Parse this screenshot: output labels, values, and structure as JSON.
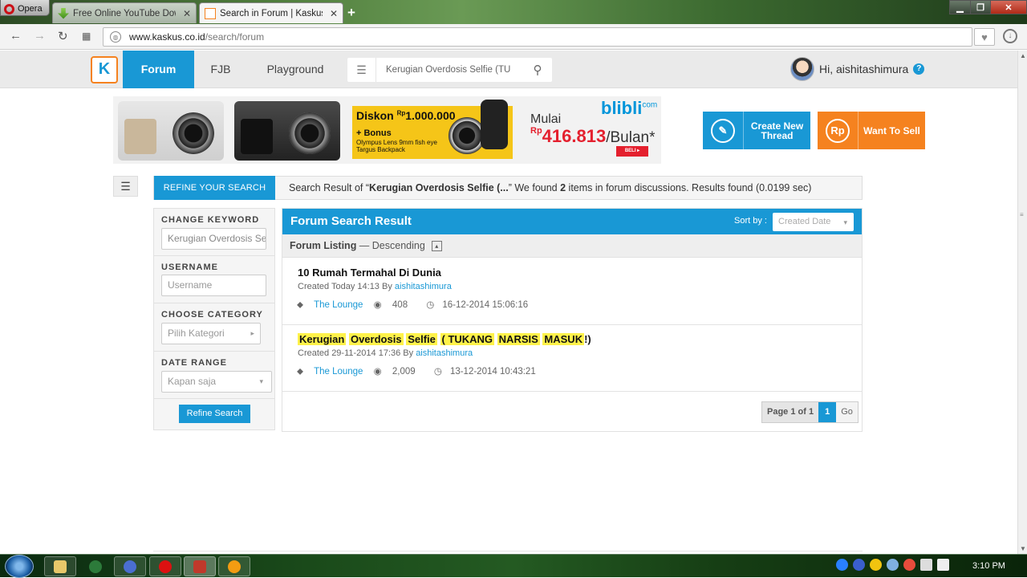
{
  "browser": {
    "menu_label": "Opera",
    "tabs": [
      {
        "title": "Free Online YouTube Dow",
        "active": false
      },
      {
        "title": "Search in Forum | Kaskus -",
        "active": true
      }
    ],
    "new_tab": "+",
    "url_host": "www.kaskus.co.id",
    "url_path": "/search/forum"
  },
  "site": {
    "logo_text": "K",
    "nav": {
      "forum": "Forum",
      "fjb": "FJB",
      "playground": "Playground"
    },
    "search_value": "Kerugian Overdosis Selfie (TU",
    "user_greeting": "Hi, aishitashimura",
    "help": "?"
  },
  "banner": {
    "diskon": "Diskon",
    "diskon_amount": "1.000.000",
    "bonus": "+ Bonus",
    "bonus_line1": "Olympus Lens 9mm fish eye",
    "bonus_line2": "Targus Backpack",
    "brand": "blibli",
    "brand_sup": "com",
    "mulai": "Mulai",
    "price_prefix": "Rp",
    "price": "416.813",
    "price_suffix": "/Bulan*",
    "beli": "BELI ▸"
  },
  "actions": {
    "create_line1": "Create New",
    "create_line2": "Thread",
    "sell": "Want To Sell",
    "sell_icon": "Rp"
  },
  "refine": {
    "label": "REFINE YOUR SEARCH",
    "result_prefix": "Search Result of “",
    "result_query": "Kerugian Overdosis Selfie (...",
    "result_mid": "” We found ",
    "result_count": "2",
    "result_suffix": " items in forum discussions. Results found (0.0199 sec)"
  },
  "sidebar": {
    "keyword_label": "CHANGE KEYWORD",
    "keyword_value": "Kerugian Overdosis Selfie",
    "username_label": "USERNAME",
    "username_placeholder": "Username",
    "category_label": "CHOOSE CATEGORY",
    "category_value": "Pilih Kategori",
    "date_label": "DATE RANGE",
    "date_value": "Kapan saja",
    "refine_button": "Refine Search"
  },
  "results": {
    "title": "Forum Search Result",
    "sort_label": "Sort by :",
    "sort_value": "Created Date",
    "listing_label": "Forum Listing",
    "listing_order": " — Descending",
    "items": [
      {
        "title": "10 Rumah Termahal Di Dunia",
        "created": "Created Today 14:13 By ",
        "author": "aishitashimura",
        "category": "The Lounge",
        "views": "408",
        "last": "16-12-2014 15:06:16"
      },
      {
        "title_words": [
          "Kerugian",
          "Overdosis",
          "Selfie",
          "( TUKANG",
          "NARSIS",
          "MASUK",
          "!)"
        ],
        "created": "Created 29-11-2014 17:36 By ",
        "author": "aishitashimura",
        "category": "The Lounge",
        "views": "2,009",
        "last": "13-12-2014 10:43:21"
      }
    ],
    "pager_info": "Page 1 of 1",
    "pager_page": "1",
    "pager_go": "Go"
  },
  "taskbar": {
    "clock": "3:10 PM"
  }
}
